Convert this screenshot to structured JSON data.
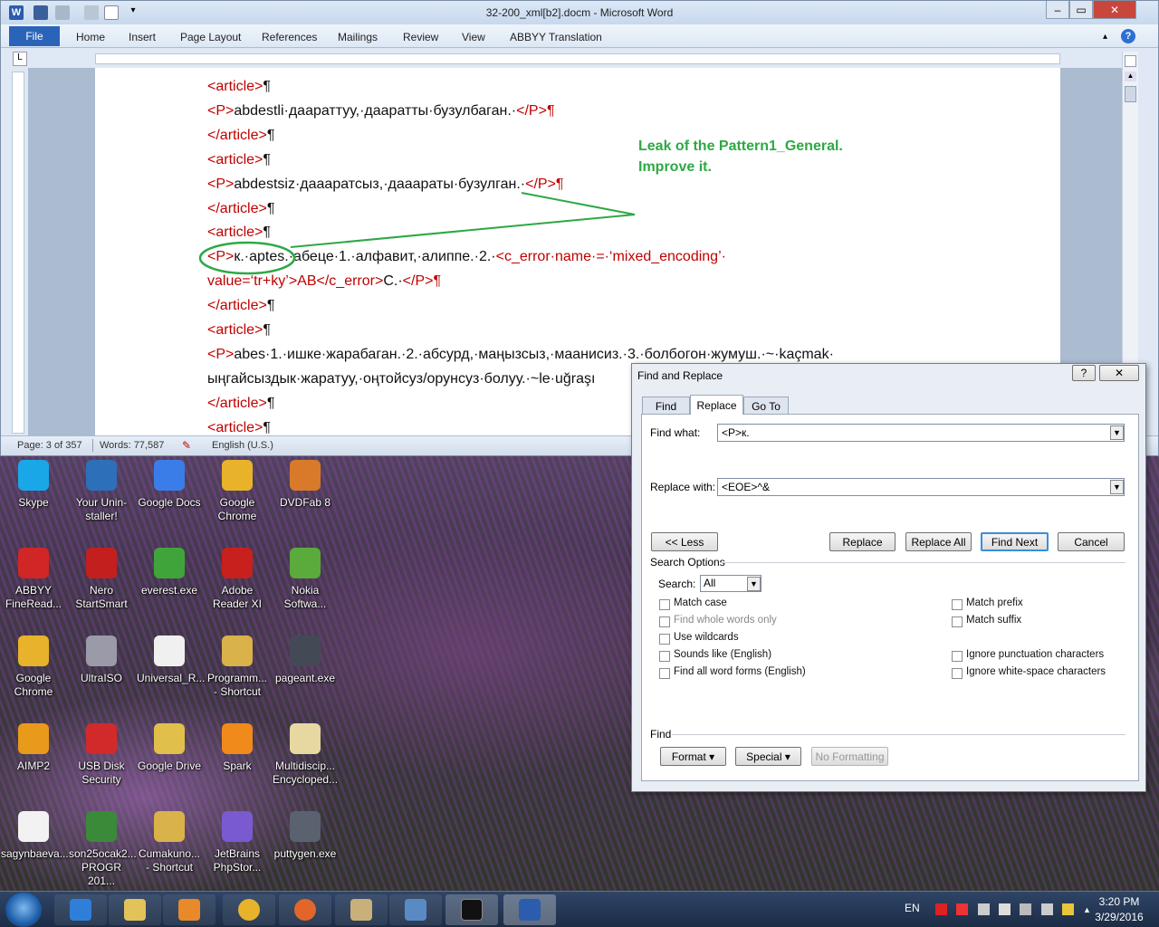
{
  "word": {
    "title": "32-200_xml[b2].docm - Microsoft Word",
    "file_tab": "File",
    "tabs": [
      "Home",
      "Insert",
      "Page Layout",
      "References",
      "Mailings",
      "Review",
      "View",
      "ABBYY Translation"
    ],
    "status": {
      "page": "Page: 3 of 357",
      "words": "Words: 77,587",
      "language": "English (U.S.)"
    },
    "doc_lines": [
      {
        "parts": [
          {
            "t": "<article>",
            "c": "red"
          },
          {
            "t": "¶",
            "c": "black"
          }
        ]
      },
      {
        "parts": [
          {
            "t": "<P>",
            "c": "red"
          },
          {
            "t": "abdestli·даараттуу,·дааратты·бузулбаган.·",
            "c": "black"
          },
          {
            "t": "</P>",
            "c": "red"
          },
          {
            "t": "¶",
            "c": "red"
          }
        ]
      },
      {
        "parts": [
          {
            "t": "</article>",
            "c": "red"
          },
          {
            "t": "¶",
            "c": "black"
          }
        ]
      },
      {
        "parts": [
          {
            "t": "<article>",
            "c": "red"
          },
          {
            "t": "¶",
            "c": "black"
          }
        ]
      },
      {
        "parts": [
          {
            "t": "<P>",
            "c": "red"
          },
          {
            "t": "abdestsiz·даааратсыз,·дааараты·бузулган.·",
            "c": "black"
          },
          {
            "t": "</P>",
            "c": "red"
          },
          {
            "t": "¶",
            "c": "red"
          }
        ]
      },
      {
        "parts": [
          {
            "t": "</article>",
            "c": "red"
          },
          {
            "t": "¶",
            "c": "black"
          }
        ]
      },
      {
        "parts": [
          {
            "t": "<article>",
            "c": "red"
          },
          {
            "t": "¶",
            "c": "black"
          }
        ]
      },
      {
        "parts": [
          {
            "t": "<P>",
            "c": "red"
          },
          {
            "t": "к.·aptes.·абеце·1.·алфавит,·алиппе.·2.·",
            "c": "black"
          },
          {
            "t": "<c_error·name·=·‘mixed_encoding’·",
            "c": "red"
          }
        ]
      },
      {
        "parts": [
          {
            "t": "value=‘tr+ky’>AB</c_error>",
            "c": "red"
          },
          {
            "t": "С.·",
            "c": "black"
          },
          {
            "t": "</P>",
            "c": "red"
          },
          {
            "t": "¶",
            "c": "red"
          }
        ]
      },
      {
        "parts": [
          {
            "t": "</article>",
            "c": "red"
          },
          {
            "t": "¶",
            "c": "black"
          }
        ]
      },
      {
        "parts": [
          {
            "t": "<article>",
            "c": "red"
          },
          {
            "t": "¶",
            "c": "black"
          }
        ]
      },
      {
        "parts": [
          {
            "t": "<P>",
            "c": "red"
          },
          {
            "t": "abes·1.·ишке·жарабаган.·2.·абсурд,·маңызсыз,·маанисиз.·3.·болбогон·жумуш.·~·kaçmak·",
            "c": "black"
          }
        ]
      },
      {
        "parts": [
          {
            "t": "ыңгайсыздык·жаратуу,·оңтойсуз/орунсуз·болуу.·~le·uğraşı",
            "c": "black"
          }
        ]
      },
      {
        "parts": [
          {
            "t": "</article>",
            "c": "red"
          },
          {
            "t": "¶",
            "c": "black"
          }
        ]
      },
      {
        "parts": [
          {
            "t": "<article>",
            "c": "red"
          },
          {
            "t": "¶",
            "c": "black"
          }
        ]
      }
    ],
    "annotation": {
      "line1": "Leak of the Pattern1_General.",
      "line2": "Improve it."
    }
  },
  "dialog": {
    "title": "Find and Replace",
    "help": "?",
    "close": "✕",
    "tabs": [
      "Find",
      "Replace",
      "Go To"
    ],
    "find_label": "Find what:",
    "find_value": "<P>к.",
    "replace_label": "Replace with:",
    "replace_value": "<EOE>^&",
    "buttons": {
      "less": "<< Less",
      "replace": "Replace",
      "replace_all": "Replace All",
      "find_next": "Find Next",
      "cancel": "Cancel"
    },
    "search_options_label": "Search Options",
    "search_label": "Search:",
    "search_value": "All",
    "options_left": [
      "Match case",
      "Find whole words only",
      "Use wildcards",
      "Sounds like (English)",
      "Find all word forms (English)"
    ],
    "options_right": [
      "Match prefix",
      "Match suffix",
      "Ignore punctuation characters",
      "Ignore white-space characters"
    ],
    "find_section": "Find",
    "format_btn": "Format ▾",
    "special_btn": "Special ▾",
    "noformat_btn": "No Formatting"
  },
  "desktop": {
    "icons": [
      {
        "label": "Skype",
        "color": "#1aa7e8"
      },
      {
        "label": "Your Unin-staller!",
        "color": "#2d6fb8"
      },
      {
        "label": "Google Docs",
        "color": "#3b7de8"
      },
      {
        "label": "Google Chrome",
        "color": "#e8b32a"
      },
      {
        "label": "DVDFab 8",
        "color": "#d97a2a"
      },
      {
        "label": "ABBYY FineRead...",
        "color": "#d02626"
      },
      {
        "label": "Nero StartSmart",
        "color": "#c41f1f"
      },
      {
        "label": "everest.exe",
        "color": "#3fa53a"
      },
      {
        "label": "Adobe Reader XI",
        "color": "#c8201c"
      },
      {
        "label": "Nokia Softwa...",
        "color": "#5aaa3c"
      },
      {
        "label": "Google Chrome",
        "color": "#e8b32a"
      },
      {
        "label": "UltraISO",
        "color": "#9a9aa8"
      },
      {
        "label": "Universal_R...",
        "color": "#f0f0f0"
      },
      {
        "label": "Programm... - Shortcut",
        "color": "#d9b24a"
      },
      {
        "label": "pageant.exe",
        "color": "#444a55"
      },
      {
        "label": "AIMP2",
        "color": "#e89a1a"
      },
      {
        "label": "USB Disk Security",
        "color": "#d22a2a"
      },
      {
        "label": "Google Drive",
        "color": "#e0c04a"
      },
      {
        "label": "Spark",
        "color": "#f08a1a"
      },
      {
        "label": "Multidiscip... Encycloped...",
        "color": "#e6d8a0"
      },
      {
        "label": "sagynbaeva...",
        "color": "#f2f2f2"
      },
      {
        "label": "son25ocak2... PROGR 201...",
        "color": "#3a8a3a"
      },
      {
        "label": "Cumakuno... - Shortcut",
        "color": "#d9b24a"
      },
      {
        "label": "JetBrains PhpStor...",
        "color": "#7a5ad0"
      },
      {
        "label": "puttygen.exe",
        "color": "#5a6270"
      }
    ]
  },
  "taskbar": {
    "lang": "EN",
    "time": "3:20 PM",
    "date": "3/29/2016"
  }
}
